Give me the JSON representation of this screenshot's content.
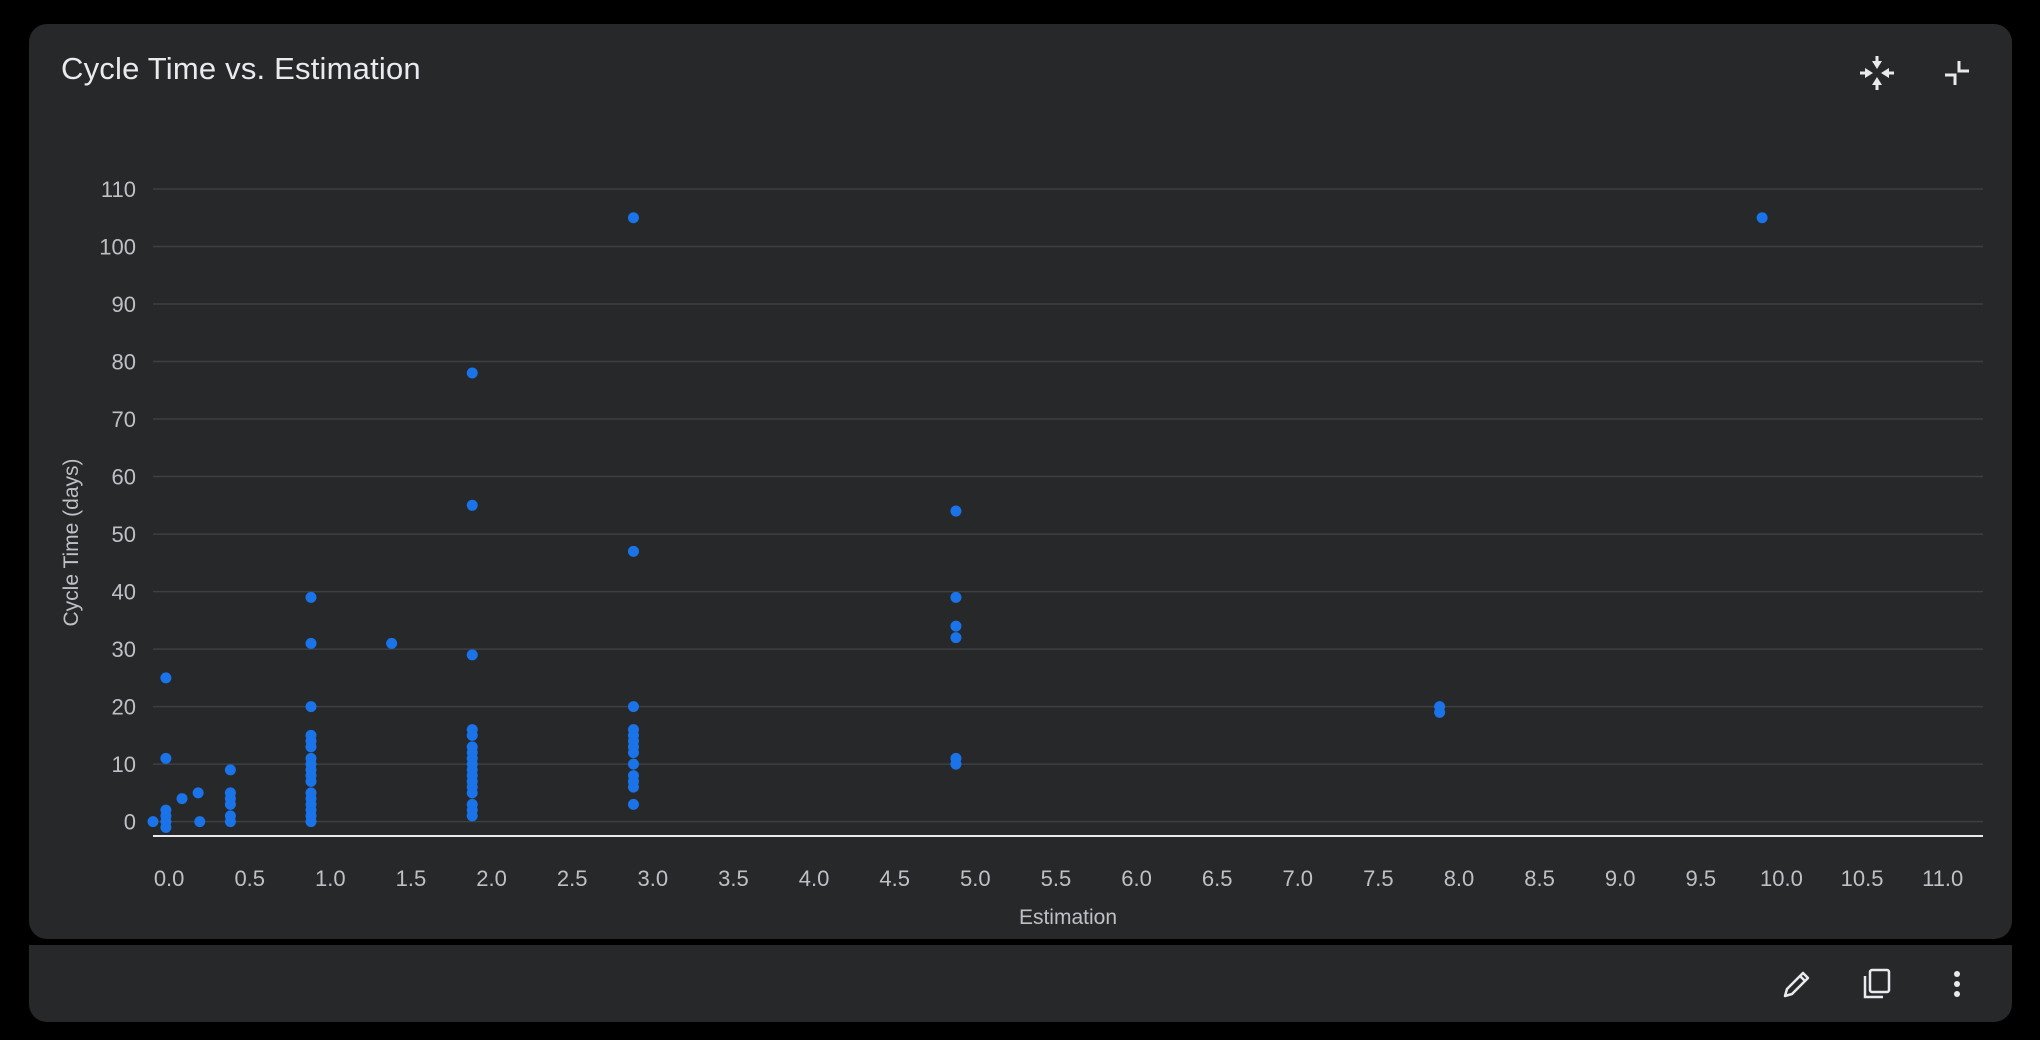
{
  "card": {
    "title": "Cycle Time vs. Estimation",
    "header_icons": [
      "collapse-arrows-icon",
      "exit-fullscreen-icon"
    ]
  },
  "footer": {
    "icons": [
      "edit-pencil-icon",
      "copy-icon",
      "more-vert-icon"
    ]
  },
  "colors": {
    "background": "#000000",
    "card": "#27282a",
    "text": "#e8eaed",
    "tick_text": "#bdc1c6",
    "gridline": "#3c4043",
    "point": "#1a73e8"
  },
  "chart_data": {
    "type": "scatter",
    "title": "Cycle Time vs. Estimation",
    "xlabel": "Estimation",
    "ylabel": "Cycle Time (days)",
    "xlim": [
      -0.1,
      11.25
    ],
    "ylim": [
      -2.5,
      110
    ],
    "x_ticks": [
      "0.0",
      "0.5",
      "1.0",
      "1.5",
      "2.0",
      "2.5",
      "3.0",
      "3.5",
      "4.0",
      "4.5",
      "5.0",
      "5.5",
      "6.0",
      "6.5",
      "7.0",
      "7.5",
      "8.0",
      "8.5",
      "9.0",
      "9.5",
      "10.0",
      "10.5",
      "11.0"
    ],
    "y_ticks": [
      "0",
      "10",
      "20",
      "30",
      "40",
      "50",
      "60",
      "70",
      "80",
      "90",
      "100",
      "110"
    ],
    "grid": true,
    "legend": "none",
    "series": [
      {
        "points": [
          [
            -0.1,
            0
          ],
          [
            -0.02,
            25
          ],
          [
            -0.02,
            11
          ],
          [
            -0.02,
            2
          ],
          [
            -0.02,
            1
          ],
          [
            -0.02,
            0
          ],
          [
            -0.02,
            -1
          ],
          [
            0.08,
            4
          ],
          [
            0.18,
            5
          ],
          [
            0.19,
            0
          ],
          [
            0.38,
            9
          ],
          [
            0.38,
            5
          ],
          [
            0.38,
            4
          ],
          [
            0.38,
            3
          ],
          [
            0.38,
            1
          ],
          [
            0.38,
            0
          ],
          [
            0.88,
            39
          ],
          [
            0.88,
            31
          ],
          [
            0.88,
            20
          ],
          [
            0.88,
            15
          ],
          [
            0.88,
            14
          ],
          [
            0.88,
            13
          ],
          [
            0.88,
            11
          ],
          [
            0.88,
            10
          ],
          [
            0.88,
            9
          ],
          [
            0.88,
            8
          ],
          [
            0.88,
            7
          ],
          [
            0.88,
            5
          ],
          [
            0.88,
            4
          ],
          [
            0.88,
            3
          ],
          [
            0.88,
            2
          ],
          [
            0.88,
            1
          ],
          [
            0.88,
            0
          ],
          [
            1.38,
            31
          ],
          [
            1.88,
            78
          ],
          [
            1.88,
            55
          ],
          [
            1.88,
            29
          ],
          [
            1.88,
            16
          ],
          [
            1.88,
            15
          ],
          [
            1.88,
            13
          ],
          [
            1.88,
            12
          ],
          [
            1.88,
            11
          ],
          [
            1.88,
            10
          ],
          [
            1.88,
            9
          ],
          [
            1.88,
            8
          ],
          [
            1.88,
            7
          ],
          [
            1.88,
            6
          ],
          [
            1.88,
            5
          ],
          [
            1.88,
            3
          ],
          [
            1.88,
            2
          ],
          [
            1.88,
            1
          ],
          [
            2.88,
            105
          ],
          [
            2.88,
            47
          ],
          [
            2.88,
            20
          ],
          [
            2.88,
            16
          ],
          [
            2.88,
            15
          ],
          [
            2.88,
            14
          ],
          [
            2.88,
            13
          ],
          [
            2.88,
            12
          ],
          [
            2.88,
            10
          ],
          [
            2.88,
            8
          ],
          [
            2.88,
            7
          ],
          [
            2.88,
            6
          ],
          [
            2.88,
            3
          ],
          [
            4.88,
            54
          ],
          [
            4.88,
            39
          ],
          [
            4.88,
            34
          ],
          [
            4.88,
            32
          ],
          [
            4.88,
            11
          ],
          [
            4.88,
            10
          ],
          [
            7.88,
            20
          ],
          [
            7.88,
            19
          ],
          [
            9.88,
            105
          ]
        ]
      }
    ]
  }
}
